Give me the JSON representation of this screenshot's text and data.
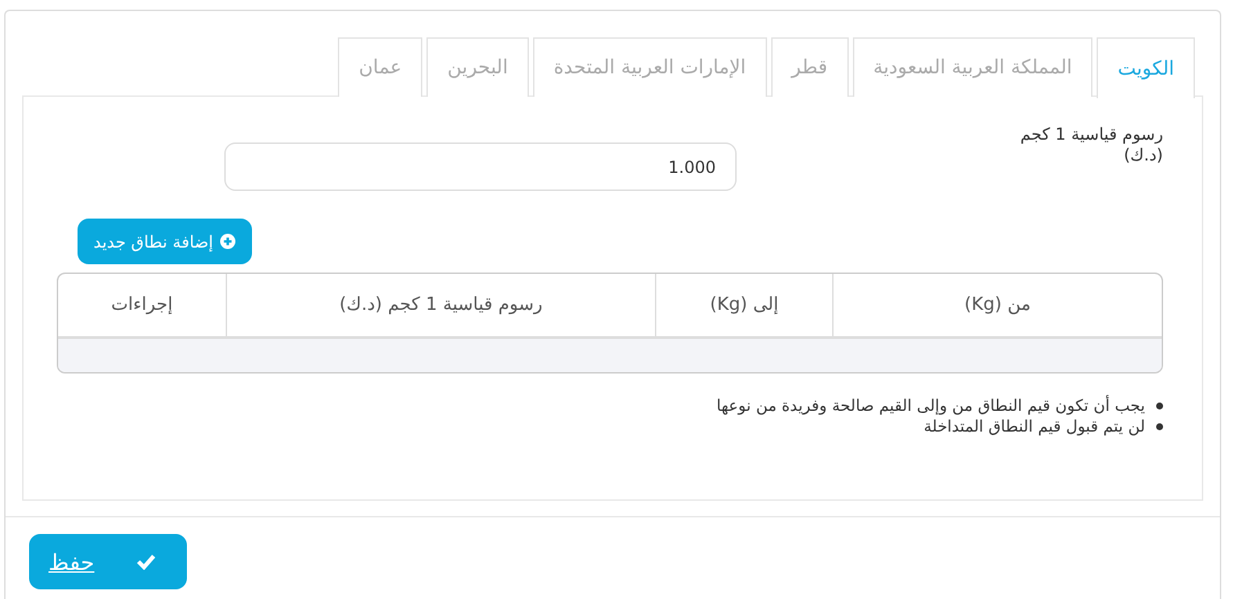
{
  "tabs": [
    {
      "label": "الكويت",
      "selected": true
    },
    {
      "label": "المملكة العربية السعودية",
      "selected": false
    },
    {
      "label": "قطر",
      "selected": false
    },
    {
      "label": "الإمارات العربية المتحدة",
      "selected": false
    },
    {
      "label": "البحرين",
      "selected": false
    },
    {
      "label": "عمان",
      "selected": false
    }
  ],
  "fee_field": {
    "label": "رسوم قياسية 1 كجم",
    "unit": "(د.ك)",
    "value": "1.000"
  },
  "add_button": {
    "label": "إضافة نطاق جديد"
  },
  "table": {
    "columns": [
      "من (Kg)",
      "إلى (Kg)",
      "رسوم قياسية 1 كجم (د.ك)",
      "إجراءات"
    ]
  },
  "notes": [
    "يجب أن تكون قيم النطاق من وإلى القيم صالحة وفريدة من نوعها",
    "لن يتم قبول قيم النطاق المتداخلة"
  ],
  "save_button": {
    "label": "حفظ"
  }
}
